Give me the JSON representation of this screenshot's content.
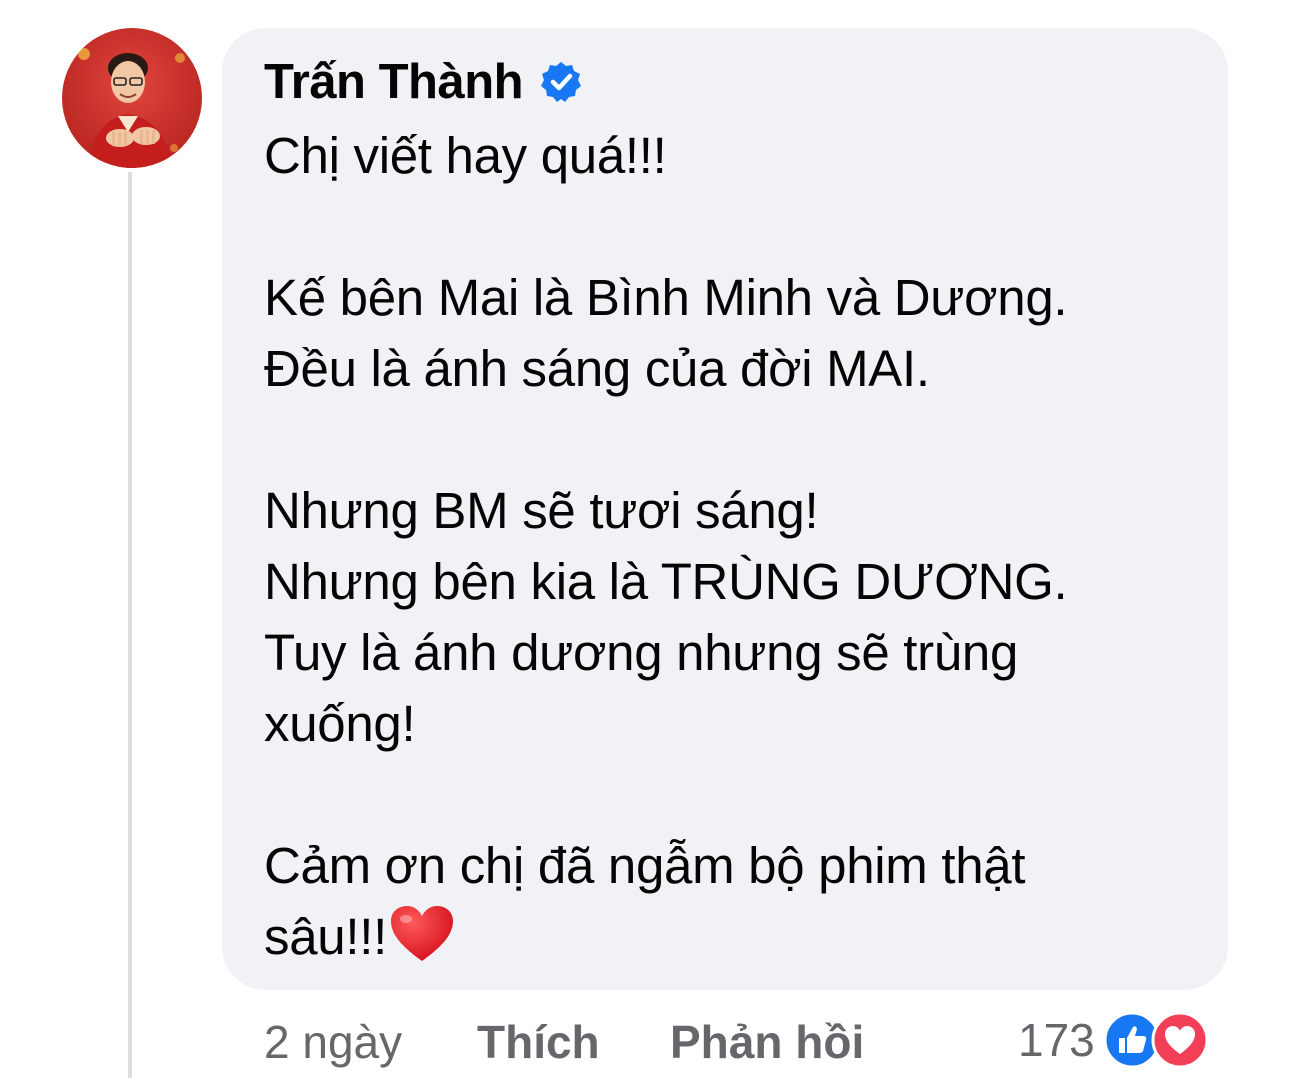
{
  "comment": {
    "author": "Trấn Thành",
    "verified_icon": "verified-badge-icon",
    "body_lines": [
      "Chị viết hay quá!!!",
      "",
      "Kế bên Mai là Bình Minh và Dương.",
      "Đều là ánh sáng của đời MAI.",
      "",
      "Nhưng BM sẽ tươi sáng!",
      "Nhưng bên kia là TRÙNG DƯƠNG.",
      "Tuy là ánh dương nhưng sẽ trùng",
      "xuống!",
      "",
      "Cảm ơn chị đã ngẫm bộ phim thật",
      "sâu!!!"
    ],
    "trailing_emoji": "red-heart-icon"
  },
  "actions": {
    "time": "2 ngày",
    "like_label": "Thích",
    "reply_label": "Phản hồi"
  },
  "reactions": {
    "count": "173",
    "icons": [
      "like-reaction-icon",
      "love-reaction-icon"
    ]
  },
  "colors": {
    "bubble_bg": "#f0f2f5",
    "text": "#050505",
    "muted": "#65676b",
    "verified_blue": "#1877f2",
    "love_red": "#f33e58"
  }
}
